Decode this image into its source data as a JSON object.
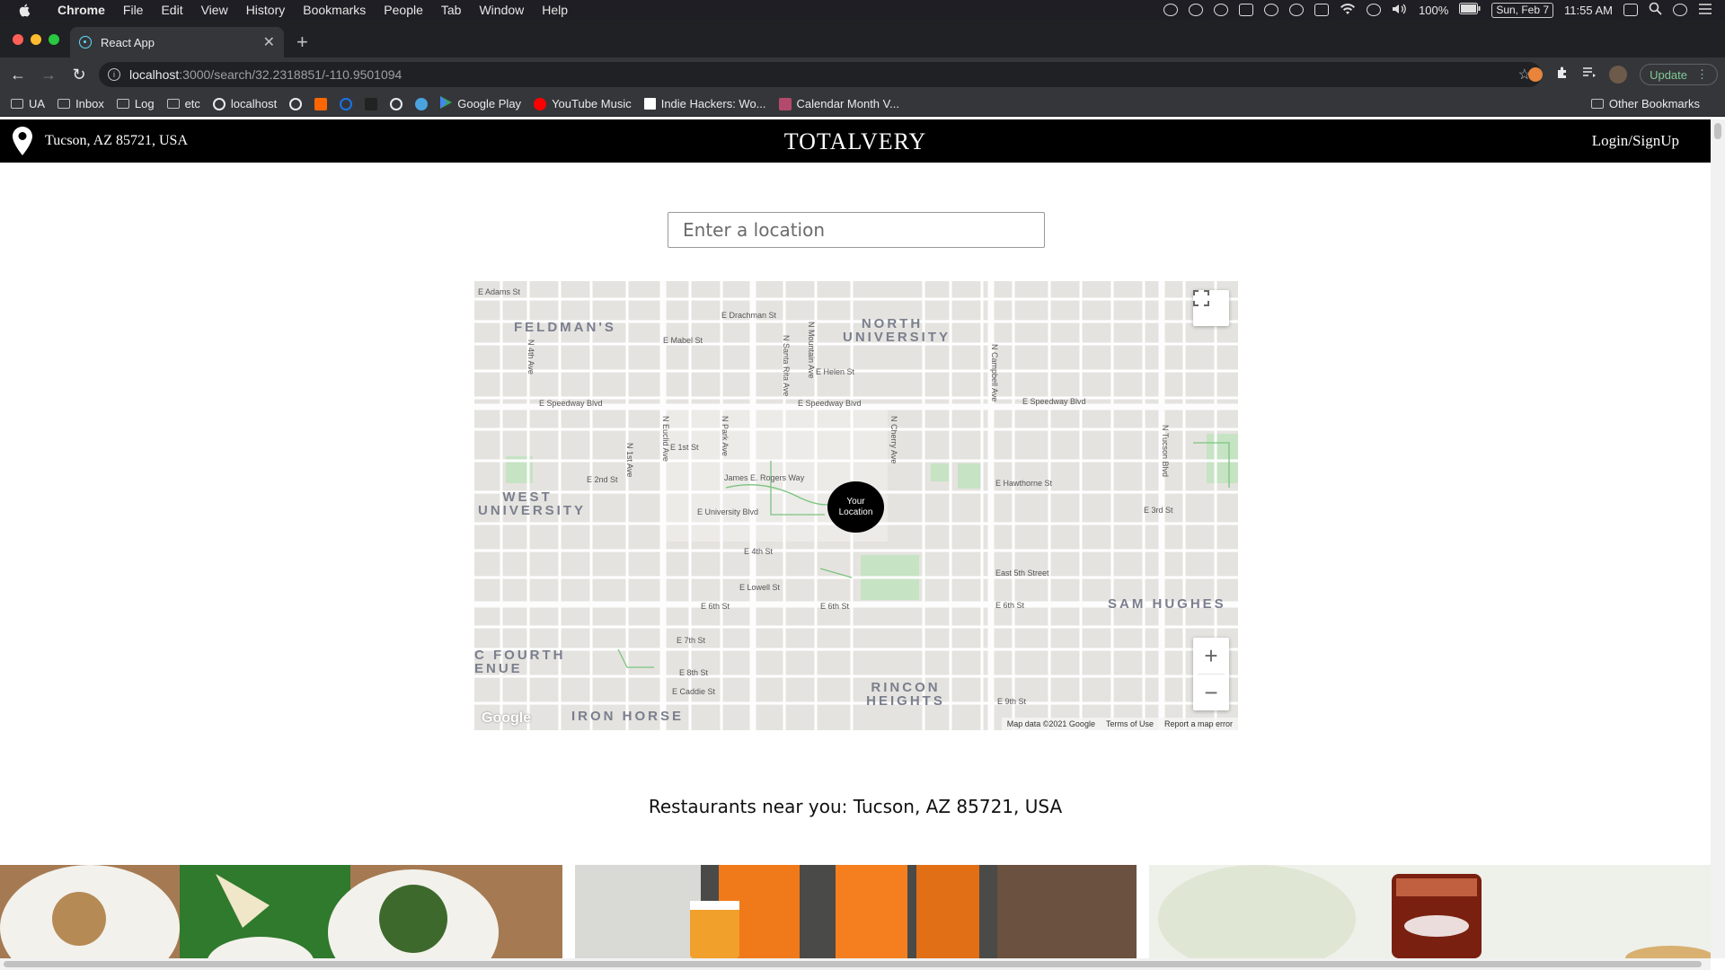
{
  "menubar": {
    "app_name": "Chrome",
    "menus": [
      "File",
      "Edit",
      "View",
      "History",
      "Bookmarks",
      "People",
      "Tab",
      "Window",
      "Help"
    ],
    "battery": "100%",
    "date": "Sun, Feb 7",
    "time": "11:55 AM"
  },
  "browser": {
    "tab_title": "React App",
    "url_host": "localhost",
    "url_path": ":3000/search/32.2318851/-110.9501094",
    "update_label": "Update",
    "bookmarks": [
      {
        "label": "UA",
        "kind": "folder"
      },
      {
        "label": "Inbox",
        "kind": "folder"
      },
      {
        "label": "Log",
        "kind": "folder"
      },
      {
        "label": "etc",
        "kind": "folder"
      },
      {
        "label": "localhost",
        "kind": "globe"
      },
      {
        "label": "Google Play",
        "kind": "play"
      },
      {
        "label": "YouTube Music",
        "kind": "ytmusic"
      },
      {
        "label": "Indie Hackers: Wo...",
        "kind": "ih"
      },
      {
        "label": "Calendar Month V...",
        "kind": "calendar"
      }
    ],
    "other_bookmarks": "Other Bookmarks"
  },
  "app": {
    "current_location": "Tucson, AZ 85721, USA",
    "brand": "TOTALVERY",
    "login_label": "Login/SignUp",
    "search_placeholder": "Enter a location",
    "marker_label": "Your Location",
    "map_footer": {
      "data": "Map data ©2021 Google",
      "terms": "Terms of Use",
      "report": "Report a map error"
    },
    "google_logo": "Google",
    "section_heading": "Restaurants near you: Tucson, AZ 85721, USA"
  },
  "map_labels": {
    "neighborhoods": [
      "FELDMAN'S",
      "NORTH UNIVERSITY",
      "WEST UNIVERSITY",
      "SAM HUGHES",
      "C FOURTH ENUE",
      "RINCON HEIGHTS",
      "IRON HORSE"
    ],
    "streets": [
      "E Adams St",
      "E Drachman St",
      "E Mabel St",
      "E Helen St",
      "E Speedway Blvd",
      "E 1st St",
      "E 2nd St",
      "E University Blvd",
      "E 4th St",
      "E Lowell St",
      "E 6th St",
      "E 7th St",
      "E 8th St",
      "E 9th St",
      "E Caddie St",
      "E Hawthorne St",
      "East 5th Street",
      "E 3rd St",
      "James E. Rogers Way",
      "N Euclid Ave",
      "N Park Ave",
      "N Mountain Ave",
      "N Campbell Ave",
      "N Tucson Blvd",
      "N Cherry Ave",
      "N Santa Rita Ave",
      "N 1st Ave",
      "N 4th Ave"
    ]
  },
  "colors": {
    "navbar_bg": "#000000",
    "map_bg": "#e5e3df",
    "park": "#c8e6c9",
    "marker": "#000000",
    "update_green": "#81c995"
  }
}
